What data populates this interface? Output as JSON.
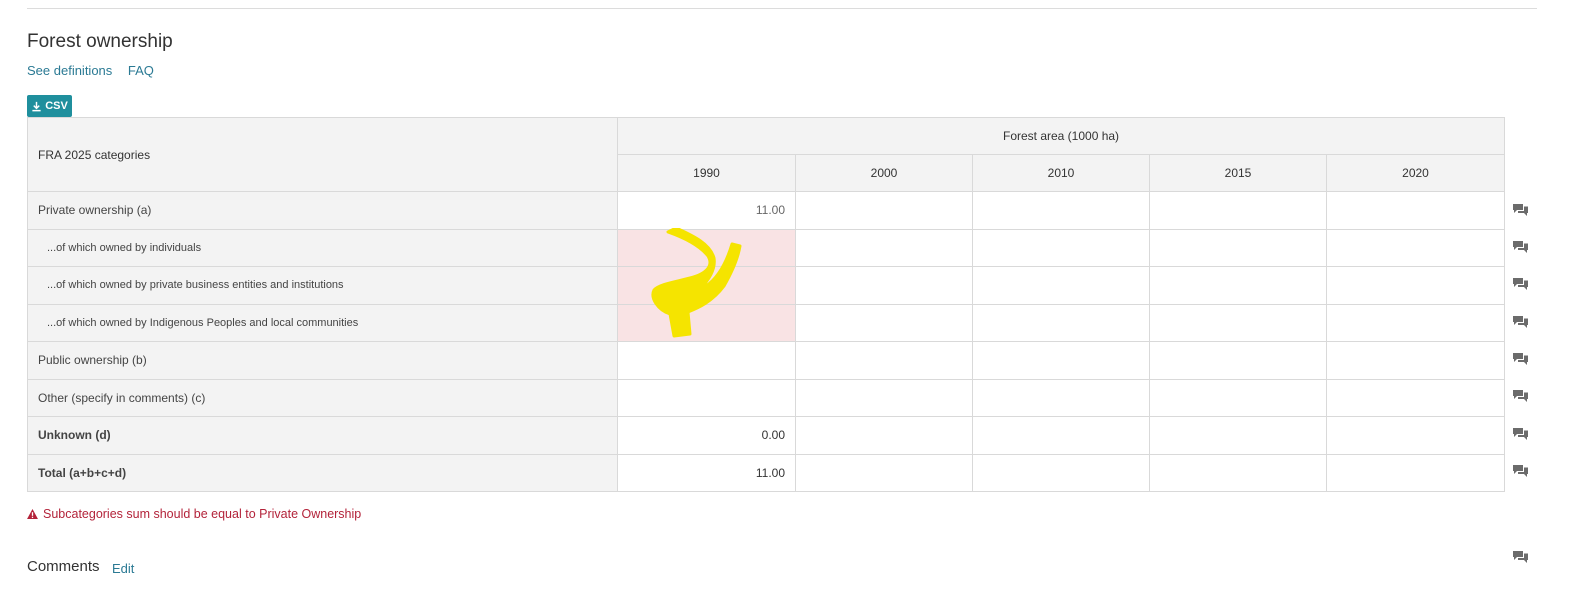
{
  "section": {
    "title": "Forest ownership",
    "links": {
      "definitions": "See definitions",
      "faq": "FAQ"
    },
    "csv_label": "CSV"
  },
  "table": {
    "category_header": "FRA 2025 categories",
    "group_header": "Forest area (1000 ha)",
    "years": [
      "1990",
      "2000",
      "2010",
      "2015",
      "2020"
    ],
    "rows": [
      {
        "label": "Private ownership (a)",
        "values": [
          "11.00",
          "",
          "",
          "",
          ""
        ]
      },
      {
        "label": "...of which owned by individuals",
        "values": [
          "",
          "",
          "",
          "",
          ""
        ]
      },
      {
        "label": "...of which owned by private business entities and institutions",
        "values": [
          "",
          "",
          "",
          "",
          ""
        ]
      },
      {
        "label": "...of which owned by Indigenous Peoples and local communities",
        "values": [
          "",
          "",
          "",
          "",
          ""
        ]
      },
      {
        "label": "Public ownership (b)",
        "values": [
          "",
          "",
          "",
          "",
          ""
        ]
      },
      {
        "label": "Other (specify in comments) (c)",
        "values": [
          "",
          "",
          "",
          "",
          ""
        ]
      },
      {
        "label": "Unknown (d)",
        "values": [
          "0.00",
          "",
          "",
          "",
          ""
        ]
      },
      {
        "label": "Total (a+b+c+d)",
        "values": [
          "11.00",
          "",
          "",
          "",
          ""
        ]
      }
    ]
  },
  "warning": "Subcategories sum should be equal to Private Ownership",
  "comments": {
    "title": "Comments",
    "edit": "Edit"
  },
  "icons": {
    "download": "download-icon",
    "comment": "comment-icon",
    "warning": "warning-icon"
  },
  "colors": {
    "accent": "#1f8f9d",
    "link": "#2b7a94",
    "error": "#b3233a",
    "error_fill": "#f9e3e4",
    "highlight": "#f5e400"
  }
}
